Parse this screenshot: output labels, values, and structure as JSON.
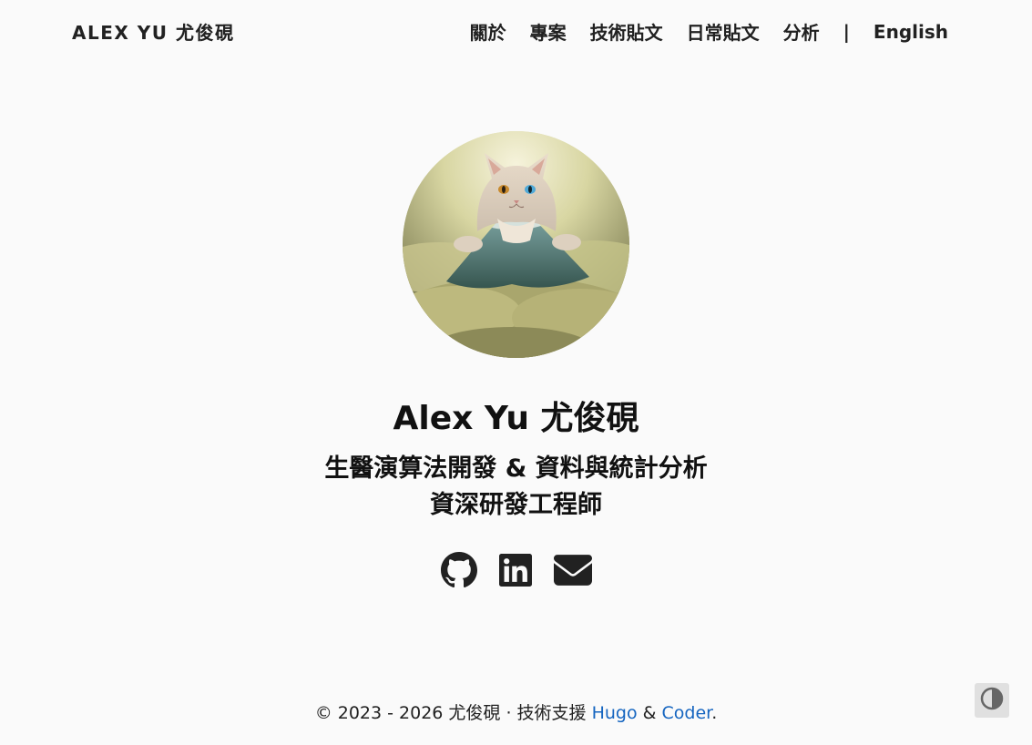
{
  "nav": {
    "brand": "ALEX YU 尤俊硯",
    "items": [
      {
        "label": "關於",
        "name": "nav-item-about"
      },
      {
        "label": "專案",
        "name": "nav-item-projects"
      },
      {
        "label": "技術貼文",
        "name": "nav-item-tech-posts"
      },
      {
        "label": "日常貼文",
        "name": "nav-item-daily-posts"
      },
      {
        "label": "分析",
        "name": "nav-item-analytics"
      }
    ],
    "separator": "|",
    "language": "English"
  },
  "profile": {
    "name": "Alex Yu 尤俊硯",
    "tagline_line1": "生醫演算法開發 & 資料與統計分析",
    "tagline_line2": "資深研發工程師"
  },
  "social": [
    {
      "icon": "github-icon"
    },
    {
      "icon": "linkedin-icon"
    },
    {
      "icon": "email-icon"
    }
  ],
  "footer": {
    "copyright": "© 2023 - 2026 尤俊硯 · 技術支援 ",
    "hugo": "Hugo",
    "amp": " & ",
    "coder": "Coder",
    "period": "."
  },
  "colors": {
    "background": "#fafafa",
    "text": "#212121",
    "link": "#1565c0",
    "toggle_bg": "#e0e0e0"
  }
}
